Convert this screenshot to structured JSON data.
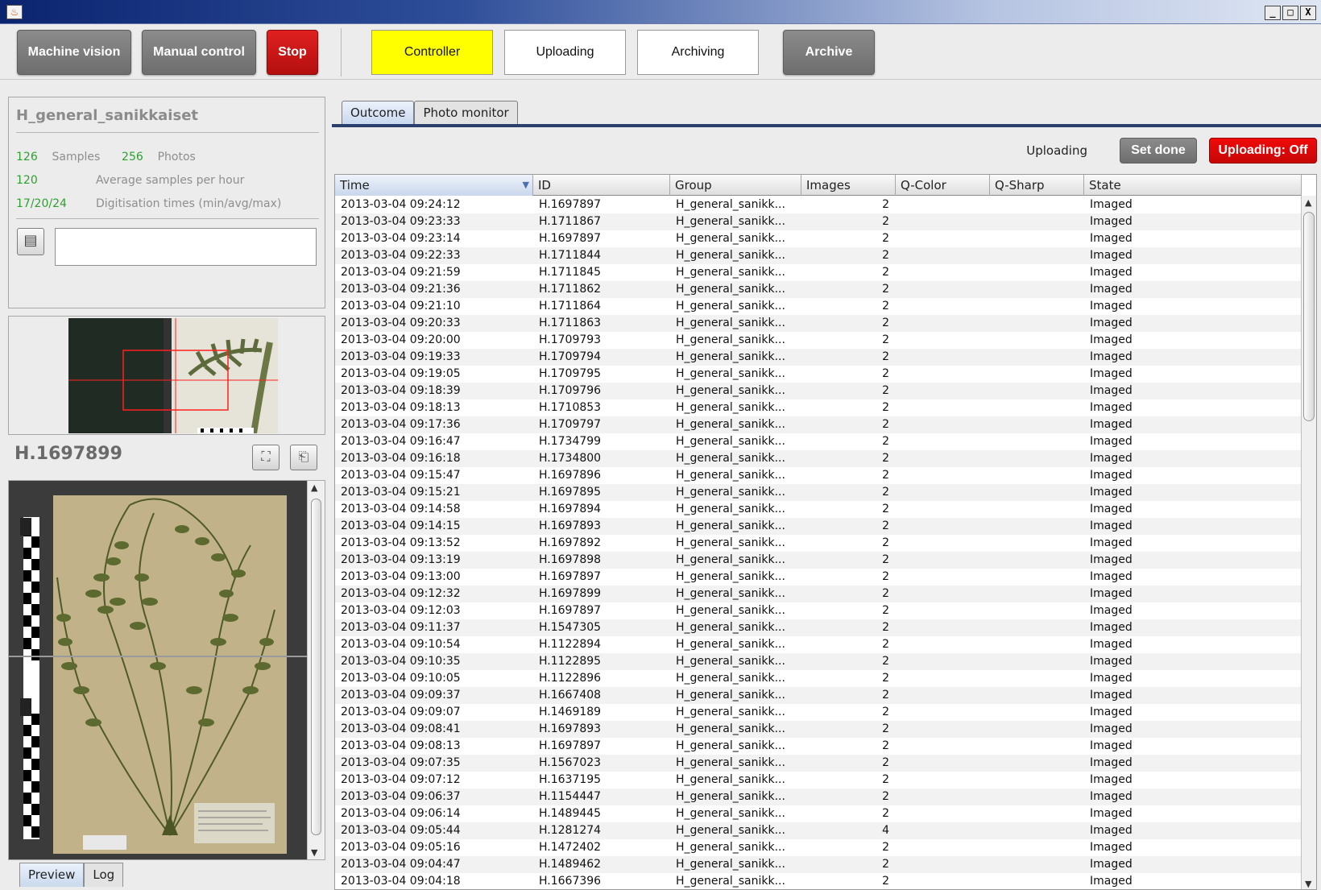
{
  "window": {
    "icon": "java-cup-icon",
    "controls": [
      "_",
      "□",
      "X"
    ]
  },
  "toolbar": {
    "machine_vision": "Machine vision",
    "manual_control": "Manual control",
    "stop": "Stop",
    "controller": "Controller",
    "uploading": "Uploading",
    "archiving": "Archiving",
    "archive": "Archive",
    "active_color": "#ffff00",
    "stop_color": "#c81414"
  },
  "stats": {
    "collection": "H_general_sanikkaiset",
    "samples_count": "126",
    "samples_label": "Samples",
    "photos_count": "256",
    "photos_label": "Photos",
    "avg_value": "120",
    "avg_label": "Average samples per hour",
    "times_value": "17/20/24",
    "times_label": "Digitisation times (min/avg/max)"
  },
  "specimen": {
    "id": "H.1697899"
  },
  "left_tabs": [
    "Preview",
    "Log"
  ],
  "tabs": [
    "Outcome",
    "Photo monitor"
  ],
  "upload": {
    "label": "Uploading",
    "set_done": "Set done",
    "toggle": "Uploading: Off"
  },
  "table": {
    "columns": [
      "Time",
      "ID",
      "Group",
      "Images",
      "Q-Color",
      "Q-Sharp",
      "State"
    ],
    "rows": [
      [
        "2013-03-04 09:24:12",
        "H.1697897",
        "H_general_sanikk...",
        "2",
        "",
        "",
        "Imaged"
      ],
      [
        "2013-03-04 09:23:33",
        "H.1711867",
        "H_general_sanikk...",
        "2",
        "",
        "",
        "Imaged"
      ],
      [
        "2013-03-04 09:23:14",
        "H.1697897",
        "H_general_sanikk...",
        "2",
        "",
        "",
        "Imaged"
      ],
      [
        "2013-03-04 09:22:33",
        "H.1711844",
        "H_general_sanikk...",
        "2",
        "",
        "",
        "Imaged"
      ],
      [
        "2013-03-04 09:21:59",
        "H.1711845",
        "H_general_sanikk...",
        "2",
        "",
        "",
        "Imaged"
      ],
      [
        "2013-03-04 09:21:36",
        "H.1711862",
        "H_general_sanikk...",
        "2",
        "",
        "",
        "Imaged"
      ],
      [
        "2013-03-04 09:21:10",
        "H.1711864",
        "H_general_sanikk...",
        "2",
        "",
        "",
        "Imaged"
      ],
      [
        "2013-03-04 09:20:33",
        "H.1711863",
        "H_general_sanikk...",
        "2",
        "",
        "",
        "Imaged"
      ],
      [
        "2013-03-04 09:20:00",
        "H.1709793",
        "H_general_sanikk...",
        "2",
        "",
        "",
        "Imaged"
      ],
      [
        "2013-03-04 09:19:33",
        "H.1709794",
        "H_general_sanikk...",
        "2",
        "",
        "",
        "Imaged"
      ],
      [
        "2013-03-04 09:19:05",
        "H.1709795",
        "H_general_sanikk...",
        "2",
        "",
        "",
        "Imaged"
      ],
      [
        "2013-03-04 09:18:39",
        "H.1709796",
        "H_general_sanikk...",
        "2",
        "",
        "",
        "Imaged"
      ],
      [
        "2013-03-04 09:18:13",
        "H.1710853",
        "H_general_sanikk...",
        "2",
        "",
        "",
        "Imaged"
      ],
      [
        "2013-03-04 09:17:36",
        "H.1709797",
        "H_general_sanikk...",
        "2",
        "",
        "",
        "Imaged"
      ],
      [
        "2013-03-04 09:16:47",
        "H.1734799",
        "H_general_sanikk...",
        "2",
        "",
        "",
        "Imaged"
      ],
      [
        "2013-03-04 09:16:18",
        "H.1734800",
        "H_general_sanikk...",
        "2",
        "",
        "",
        "Imaged"
      ],
      [
        "2013-03-04 09:15:47",
        "H.1697896",
        "H_general_sanikk...",
        "2",
        "",
        "",
        "Imaged"
      ],
      [
        "2013-03-04 09:15:21",
        "H.1697895",
        "H_general_sanikk...",
        "2",
        "",
        "",
        "Imaged"
      ],
      [
        "2013-03-04 09:14:58",
        "H.1697894",
        "H_general_sanikk...",
        "2",
        "",
        "",
        "Imaged"
      ],
      [
        "2013-03-04 09:14:15",
        "H.1697893",
        "H_general_sanikk...",
        "2",
        "",
        "",
        "Imaged"
      ],
      [
        "2013-03-04 09:13:52",
        "H.1697892",
        "H_general_sanikk...",
        "2",
        "",
        "",
        "Imaged"
      ],
      [
        "2013-03-04 09:13:19",
        "H.1697898",
        "H_general_sanikk...",
        "2",
        "",
        "",
        "Imaged"
      ],
      [
        "2013-03-04 09:13:00",
        "H.1697897",
        "H_general_sanikk...",
        "2",
        "",
        "",
        "Imaged"
      ],
      [
        "2013-03-04 09:12:32",
        "H.1697899",
        "H_general_sanikk...",
        "2",
        "",
        "",
        "Imaged"
      ],
      [
        "2013-03-04 09:12:03",
        "H.1697897",
        "H_general_sanikk...",
        "2",
        "",
        "",
        "Imaged"
      ],
      [
        "2013-03-04 09:11:37",
        "H.1547305",
        "H_general_sanikk...",
        "2",
        "",
        "",
        "Imaged"
      ],
      [
        "2013-03-04 09:10:54",
        "H.1122894",
        "H_general_sanikk...",
        "2",
        "",
        "",
        "Imaged"
      ],
      [
        "2013-03-04 09:10:35",
        "H.1122895",
        "H_general_sanikk...",
        "2",
        "",
        "",
        "Imaged"
      ],
      [
        "2013-03-04 09:10:05",
        "H.1122896",
        "H_general_sanikk...",
        "2",
        "",
        "",
        "Imaged"
      ],
      [
        "2013-03-04 09:09:37",
        "H.1667408",
        "H_general_sanikk...",
        "2",
        "",
        "",
        "Imaged"
      ],
      [
        "2013-03-04 09:09:07",
        "H.1469189",
        "H_general_sanikk...",
        "2",
        "",
        "",
        "Imaged"
      ],
      [
        "2013-03-04 09:08:41",
        "H.1697893",
        "H_general_sanikk...",
        "2",
        "",
        "",
        "Imaged"
      ],
      [
        "2013-03-04 09:08:13",
        "H.1697897",
        "H_general_sanikk...",
        "2",
        "",
        "",
        "Imaged"
      ],
      [
        "2013-03-04 09:07:35",
        "H.1567023",
        "H_general_sanikk...",
        "2",
        "",
        "",
        "Imaged"
      ],
      [
        "2013-03-04 09:07:12",
        "H.1637195",
        "H_general_sanikk...",
        "2",
        "",
        "",
        "Imaged"
      ],
      [
        "2013-03-04 09:06:37",
        "H.1154447",
        "H_general_sanikk...",
        "2",
        "",
        "",
        "Imaged"
      ],
      [
        "2013-03-04 09:06:14",
        "H.1489445",
        "H_general_sanikk...",
        "2",
        "",
        "",
        "Imaged"
      ],
      [
        "2013-03-04 09:05:44",
        "H.1281274",
        "H_general_sanikk...",
        "4",
        "",
        "",
        "Imaged"
      ],
      [
        "2013-03-04 09:05:16",
        "H.1472402",
        "H_general_sanikk...",
        "2",
        "",
        "",
        "Imaged"
      ],
      [
        "2013-03-04 09:04:47",
        "H.1489462",
        "H_general_sanikk...",
        "2",
        "",
        "",
        "Imaged"
      ],
      [
        "2013-03-04 09:04:18",
        "H.1667396",
        "H_general_sanikk...",
        "2",
        "",
        "",
        "Imaged"
      ]
    ]
  }
}
